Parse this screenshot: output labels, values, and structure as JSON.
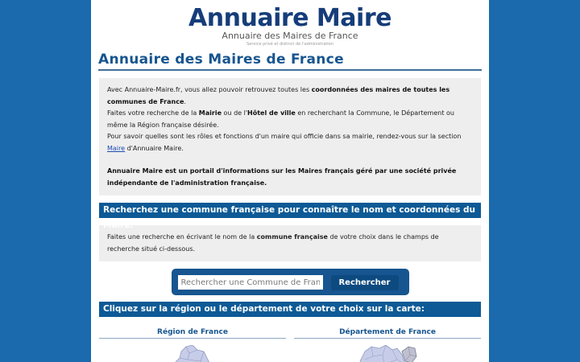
{
  "site": {
    "logo_title": "Annuaire Maire",
    "logo_subtitle": "Annuaire des Maires de France",
    "logo_tagline": "Service privé et distinct de l'administration"
  },
  "page_title": "Annuaire des Maires de France",
  "intro": {
    "p1_a": "Avec Annuaire-Maire.fr, vous allez pouvoir retrouvez toutes les ",
    "p1_b": "coordonnées des maires de toutes les communes de France",
    "p1_c": ".",
    "p2_a": "Faites votre recherche de la ",
    "p2_b": "Mairie",
    "p2_c": " ou de l'",
    "p2_d": "Hôtel de ville",
    "p2_e": " en recherchant la Commune, le Département ou même la Région française désirée.",
    "p3_a": "Pour savoir quelles sont les rôles et fonctions d'un maire qui officie dans sa mairie, rendez-vous sur la section ",
    "p3_link": "Maire",
    "p3_b": " d'Annuaire Maire.",
    "p4": "Annuaire Maire est un portail d'informations sur les Maires français géré par une société privée indépendante de l'administration française."
  },
  "search_section": {
    "bar_title": "Recherchez une commune française pour connaître le nom et coordonnées du Maire:",
    "hint_a": "Faites une recherche en écrivant le nom de la ",
    "hint_b": "commune française",
    "hint_c": " de votre choix dans le champs de recherche situé ci-dessous.",
    "placeholder": "Rechercher une Commune de France",
    "button_label": "Rechercher"
  },
  "map_section": {
    "bar_title": "Cliquez sur la région ou le département de votre choix sur la carte:",
    "left_label": "Région de France",
    "right_label": "Département de France"
  },
  "colors": {
    "background": "#1a6aad",
    "brand_dark": "#163d7a",
    "section_bar": "#0d5a96"
  }
}
